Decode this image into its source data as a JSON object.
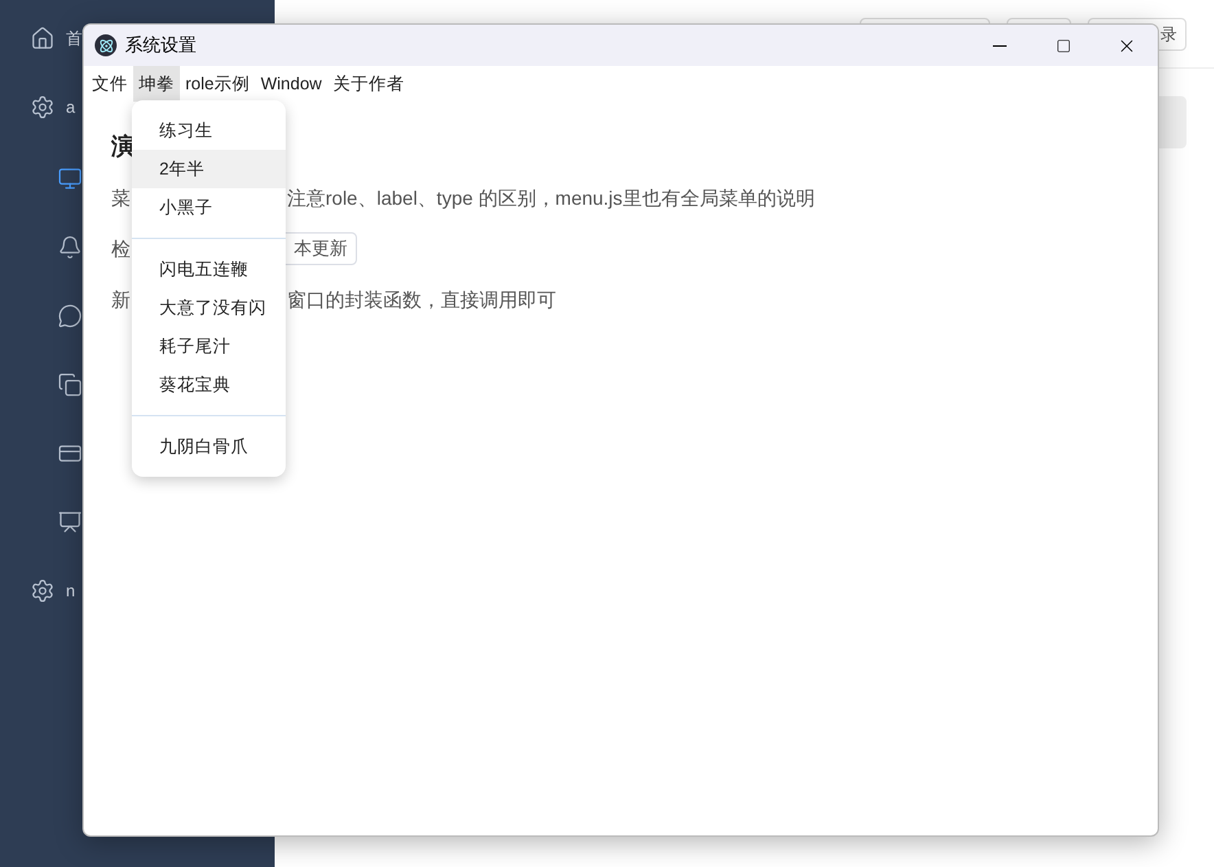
{
  "app": {
    "sidebar": {
      "items": [
        {
          "label": "首",
          "selected": false
        },
        {
          "label": "a",
          "selected": false
        },
        {
          "selected": true
        },
        {
          "selected": false
        },
        {
          "selected": false
        },
        {
          "selected": false
        },
        {
          "selected": false
        },
        {
          "selected": false
        },
        {
          "label": "n",
          "selected": false
        }
      ]
    },
    "header_button": "录"
  },
  "window": {
    "title": "系统设置",
    "menubar": [
      {
        "label": "文件",
        "selected": false
      },
      {
        "label": "坤拳",
        "selected": true
      },
      {
        "label": "role示例",
        "selected": false
      },
      {
        "label": "Window",
        "selected": false
      },
      {
        "label": "关于作者",
        "selected": false
      }
    ],
    "content": {
      "heading": "演",
      "lines": [
        {
          "kind": "text",
          "start": "菜",
          "rest": "注意role、label、type 的区别，menu.js里也有全局菜单的说明"
        },
        {
          "kind": "button",
          "start": "检",
          "rest": "本更新"
        },
        {
          "kind": "text",
          "start": "新",
          "rest": "窗口的封装函数，直接调用即可"
        }
      ]
    },
    "dropdown": [
      {
        "kind": "item",
        "label": "练习生",
        "selected": false
      },
      {
        "kind": "item",
        "label": "2年半",
        "selected": true
      },
      {
        "kind": "item",
        "label": "小黑子",
        "selected": false
      },
      {
        "kind": "separator"
      },
      {
        "kind": "item",
        "label": "闪电五连鞭",
        "selected": false
      },
      {
        "kind": "item",
        "label": "大意了没有闪",
        "selected": false
      },
      {
        "kind": "item",
        "label": "耗子尾汁",
        "selected": false
      },
      {
        "kind": "item",
        "label": "葵花宝典",
        "selected": false
      },
      {
        "kind": "separator"
      },
      {
        "kind": "item",
        "label": "九阴白骨爪",
        "selected": false
      }
    ]
  }
}
